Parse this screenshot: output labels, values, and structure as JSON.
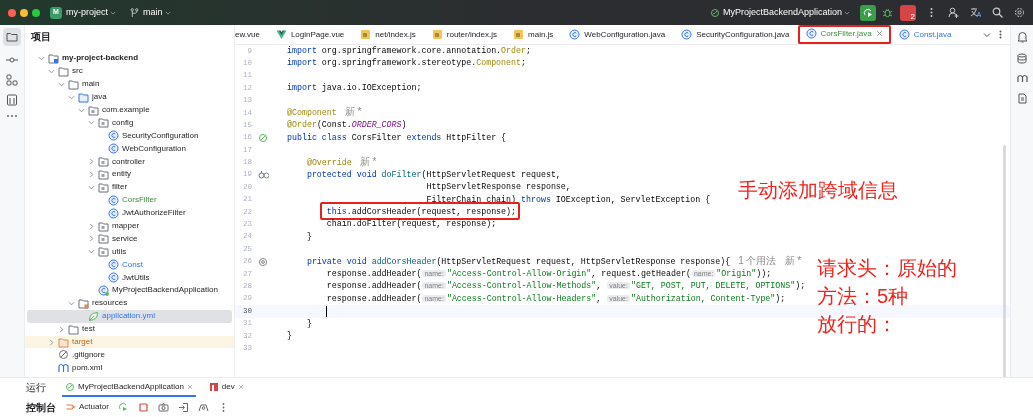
{
  "title_bar": {
    "project_badge": "M",
    "project": "my-project",
    "branch": "main",
    "run_config": "MyProjectBackendApplication",
    "stop_badge": "2"
  },
  "project_panel": {
    "title": "项目",
    "tree": [
      {
        "label": "my-project-backend",
        "kind": "module",
        "expanded": true,
        "selected": false,
        "children": [
          {
            "label": "src",
            "kind": "folder",
            "expanded": true,
            "selected": false,
            "children": [
              {
                "label": "main",
                "kind": "folder",
                "expanded": true,
                "selected": false,
                "children": [
                  {
                    "label": "java",
                    "kind": "source",
                    "expanded": true,
                    "selected": false,
                    "children": [
                      {
                        "label": "com.example",
                        "kind": "package",
                        "expanded": true,
                        "selected": false,
                        "children": [
                          {
                            "label": "config",
                            "kind": "package",
                            "expanded": true,
                            "selected": false,
                            "children": [
                              {
                                "label": "SecurityConfiguration",
                                "kind": "class",
                                "selected": false
                              },
                              {
                                "label": "WebConfiguration",
                                "kind": "class",
                                "selected": false
                              }
                            ]
                          },
                          {
                            "label": "controller",
                            "kind": "package",
                            "expanded": false,
                            "selected": false
                          },
                          {
                            "label": "entity",
                            "kind": "package",
                            "expanded": false,
                            "selected": false
                          },
                          {
                            "label": "filter",
                            "kind": "package",
                            "expanded": true,
                            "selected": false,
                            "children": [
                              {
                                "label": "CorsFilter",
                                "kind": "class",
                                "added": true,
                                "selected": false
                              },
                              {
                                "label": "JwtAuthorizeFilter",
                                "kind": "class",
                                "selected": false
                              }
                            ]
                          },
                          {
                            "label": "mapper",
                            "kind": "package",
                            "expanded": false,
                            "selected": false
                          },
                          {
                            "label": "service",
                            "kind": "package",
                            "expanded": false,
                            "selected": false
                          },
                          {
                            "label": "utils",
                            "kind": "package",
                            "expanded": true,
                            "selected": false,
                            "children": [
                              {
                                "label": "Const",
                                "kind": "class",
                                "modified": true,
                                "selected": false
                              },
                              {
                                "label": "JwtUtils",
                                "kind": "class",
                                "selected": false
                              }
                            ]
                          },
                          {
                            "label": "MyProjectBackendApplication",
                            "kind": "app",
                            "selected": false
                          }
                        ]
                      }
                    ]
                  },
                  {
                    "label": "resources",
                    "kind": "resources",
                    "expanded": true,
                    "selected": false,
                    "children": [
                      {
                        "label": "application.yml",
                        "kind": "yml",
                        "modified": true,
                        "selected": true
                      }
                    ]
                  }
                ]
              },
              {
                "label": "test",
                "kind": "folder",
                "expanded": false,
                "selected": false
              }
            ]
          },
          {
            "label": "target",
            "kind": "excluded",
            "expanded": false,
            "selected": false
          },
          {
            "label": ".gitignore",
            "kind": "ignore",
            "selected": false
          },
          {
            "label": "pom.xml",
            "kind": "maven",
            "selected": false
          }
        ]
      }
    ]
  },
  "tabs": [
    {
      "label": "ew.vue",
      "kind": "plain",
      "selected": false,
      "highlighted": false
    },
    {
      "label": "LoginPage.vue",
      "kind": "vue",
      "selected": false,
      "highlighted": false
    },
    {
      "label": "net/index.js",
      "kind": "js",
      "selected": false,
      "highlighted": false
    },
    {
      "label": "router/index.js",
      "kind": "js",
      "selected": false,
      "highlighted": false
    },
    {
      "label": "main.js",
      "kind": "js",
      "selected": false,
      "highlighted": false
    },
    {
      "label": "WebConfiguration.java",
      "kind": "class",
      "selected": false,
      "highlighted": false
    },
    {
      "label": "SecurityConfiguration.java",
      "kind": "class",
      "selected": false,
      "highlighted": false
    },
    {
      "label": "CorsFilter.java",
      "kind": "class",
      "added": true,
      "selected": true,
      "highlighted": true
    },
    {
      "label": "Const.java",
      "kind": "class",
      "modified": true,
      "selected": false,
      "highlighted": false
    }
  ],
  "code": {
    "lines": [
      {
        "number": "9",
        "segments": [
          {
            "kind": "kw",
            "text": "import"
          },
          {
            "kind": "plain",
            "text": " org.springframework.core.annotation."
          },
          {
            "kind": "ann",
            "text": "Order"
          },
          {
            "kind": "plain",
            "text": ";"
          }
        ]
      },
      {
        "number": "10",
        "segments": [
          {
            "kind": "kw",
            "text": "import"
          },
          {
            "kind": "plain",
            "text": " org.springframework.stereotype."
          },
          {
            "kind": "ann",
            "text": "Component"
          },
          {
            "kind": "plain",
            "text": ";"
          }
        ]
      },
      {
        "number": "11"
      },
      {
        "number": "12",
        "segments": [
          {
            "kind": "kw",
            "text": "import"
          },
          {
            "kind": "plain",
            "text": " java.io.IOException;"
          }
        ]
      },
      {
        "number": "13"
      },
      {
        "number": "14",
        "segments": [
          {
            "kind": "ann",
            "text": "@Component"
          },
          {
            "kind": "meta",
            "text": "新 *"
          }
        ]
      },
      {
        "number": "15",
        "segments": [
          {
            "kind": "ann",
            "text": "@Order"
          },
          {
            "kind": "plain",
            "text": "(Const."
          },
          {
            "kind": "const",
            "text": "ORDER_CORS"
          },
          {
            "kind": "plain",
            "text": ")"
          }
        ]
      },
      {
        "number": "16",
        "gutter": {
          "kind": "bean"
        },
        "segments": [
          {
            "kind": "kw",
            "text": "public class"
          },
          {
            "kind": "plain",
            "text": " CorsFilter "
          },
          {
            "kind": "kw",
            "text": "extends"
          },
          {
            "kind": "plain",
            "text": " HttpFilter {"
          }
        ]
      },
      {
        "number": "17"
      },
      {
        "number": "18",
        "segments": [
          {
            "kind": "ann",
            "text": "    @Override"
          },
          {
            "kind": "meta",
            "text": "新 *"
          }
        ]
      },
      {
        "number": "19",
        "gutter": {
          "kind": "override"
        },
        "segments": [
          {
            "kind": "kw",
            "text": "    protected void"
          },
          {
            "kind": "method",
            "text": " doFilter"
          },
          {
            "kind": "plain",
            "text": "(HttpServletRequest request,"
          }
        ]
      },
      {
        "number": "20",
        "segments": [
          {
            "kind": "plain",
            "text": "                            HttpServletResponse response,"
          }
        ]
      },
      {
        "number": "21",
        "segments": [
          {
            "kind": "plain",
            "text": "                            FilterChain chain) "
          },
          {
            "kind": "kw",
            "text": "throws"
          },
          {
            "kind": "plain",
            "text": " IOException, ServletException {"
          }
        ]
      },
      {
        "number": "22",
        "highlighted": true,
        "segments": [
          {
            "kind": "kw",
            "text": "        this"
          },
          {
            "kind": "plain",
            "text": ".addCorsHeader(request, response);"
          }
        ]
      },
      {
        "number": "23",
        "segments": [
          {
            "kind": "plain",
            "text": "        chain.doFilter(request, response);"
          }
        ]
      },
      {
        "number": "24",
        "segments": [
          {
            "kind": "plain",
            "text": "    }"
          }
        ]
      },
      {
        "number": "25"
      },
      {
        "number": "26",
        "gutter": {
          "kind": "usage"
        },
        "segments": [
          {
            "kind": "kw",
            "text": "    private void"
          },
          {
            "kind": "method",
            "text": " addCorsHeader"
          },
          {
            "kind": "plain",
            "text": "(HttpServletRequest request, HttpServletResponse response){"
          },
          {
            "kind": "meta",
            "text": "1 个用法"
          },
          {
            "kind": "meta",
            "text": "新 *"
          }
        ]
      },
      {
        "number": "27",
        "segments": [
          {
            "kind": "plain",
            "text": "        response.addHeader("
          },
          {
            "kind": "hint",
            "text": "name:"
          },
          {
            "kind": "str",
            "text": "\"Access-Control-Allow-Origin\""
          },
          {
            "kind": "plain",
            "text": ", request.getHeader("
          },
          {
            "kind": "hint",
            "text": "name:"
          },
          {
            "kind": "str",
            "text": "\"Origin\""
          },
          {
            "kind": "plain",
            "text": "));"
          }
        ]
      },
      {
        "number": "28",
        "segments": [
          {
            "kind": "plain",
            "text": "        response.addHeader("
          },
          {
            "kind": "hint",
            "text": "name:"
          },
          {
            "kind": "str",
            "text": "\"Access-Control-Allow-Methods\""
          },
          {
            "kind": "plain",
            "text": ","
          },
          {
            "kind": "hint",
            "text": "value:"
          },
          {
            "kind": "str",
            "text": "\"GET, POST, PUT, DELETE, OPTIONS\""
          },
          {
            "kind": "plain",
            "text": ");"
          }
        ]
      },
      {
        "number": "29",
        "segments": [
          {
            "kind": "plain",
            "text": "        response.addHeader("
          },
          {
            "kind": "hint",
            "text": "name:"
          },
          {
            "kind": "str",
            "text": "\"Access-Control-Allow-Headers\""
          },
          {
            "kind": "plain",
            "text": ","
          },
          {
            "kind": "hint",
            "text": "value:"
          },
          {
            "kind": "str",
            "text": "\"Authorization, Content-Type\""
          },
          {
            "kind": "plain",
            "text": ");"
          }
        ]
      },
      {
        "number": "30",
        "current": true
      },
      {
        "number": "31",
        "segments": [
          {
            "kind": "plain",
            "text": "    }"
          }
        ]
      },
      {
        "number": "32",
        "segments": [
          {
            "kind": "plain",
            "text": "}"
          }
        ]
      },
      {
        "number": "33"
      }
    ]
  },
  "notes": [
    {
      "lines": [
        "手动添加跨域信息"
      ]
    },
    {
      "lines": [
        "请求头：原始的",
        "方法：5种",
        "放行的："
      ]
    }
  ],
  "run_panel": {
    "title": "运行",
    "tabs": [
      {
        "label": "MyProjectBackendApplication",
        "kind": "spring",
        "selected": true
      },
      {
        "label": "dev",
        "kind": "npm",
        "selected": false
      }
    ],
    "toolbar": [
      {
        "label": "控制台",
        "kind": "text",
        "selected": true
      },
      {
        "label": "Actuator",
        "kind": "actuator",
        "selected": false
      }
    ]
  }
}
